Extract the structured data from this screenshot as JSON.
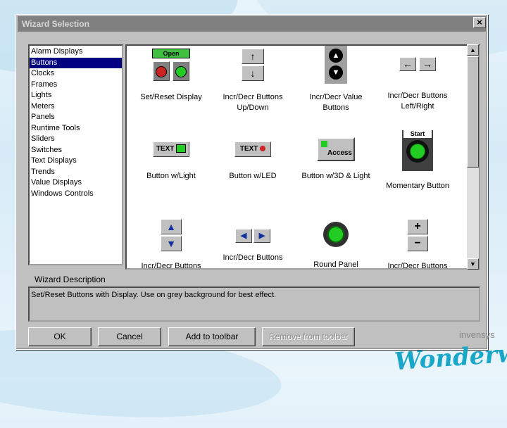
{
  "window": {
    "title": "Wizard Selection",
    "close": "×"
  },
  "categories": [
    {
      "label": "Alarm Displays"
    },
    {
      "label": "Buttons"
    },
    {
      "label": "Clocks"
    },
    {
      "label": "Frames"
    },
    {
      "label": "Lights"
    },
    {
      "label": "Meters"
    },
    {
      "label": "Panels"
    },
    {
      "label": "Runtime Tools"
    },
    {
      "label": "Sliders"
    },
    {
      "label": "Switches"
    },
    {
      "label": "Text Displays"
    },
    {
      "label": "Trends"
    },
    {
      "label": "Value Displays"
    },
    {
      "label": "Windows Controls"
    }
  ],
  "selected_category": "Buttons",
  "wizards": [
    {
      "label": "Set/Reset Display",
      "icon": "set-reset-display-icon",
      "icon_text": "Open"
    },
    {
      "label": "Incr/Decr Buttons\nUp/Down",
      "icon": "up-down-arrows-icon"
    },
    {
      "label": "Incr/Decr Value\nButtons",
      "icon": "value-buttons-icon"
    },
    {
      "label": "Incr/Decr Buttons\nLeft/Right",
      "icon": "left-right-arrows-icon"
    },
    {
      "label": "Button w/Light",
      "icon": "button-with-light-icon",
      "icon_text": "TEXT"
    },
    {
      "label": "Button w/LED",
      "icon": "button-with-led-icon",
      "icon_text": "TEXT"
    },
    {
      "label": "Button w/3D & Light",
      "icon": "button-3d-light-icon",
      "icon_text": "Access"
    },
    {
      "label": "Momentary Button",
      "icon": "momentary-button-icon",
      "icon_text": "Start"
    },
    {
      "label": "Incr/Decr Buttons",
      "icon": "triangle-up-down-icon"
    },
    {
      "label": "Incr/Decr Buttons",
      "icon": "triangle-left-right-icon"
    },
    {
      "label": "Round Panel",
      "icon": "round-panel-icon"
    },
    {
      "label": "Incr/Decr Buttons",
      "icon": "plus-minus-icon"
    }
  ],
  "description": {
    "label": "Wizard Description",
    "text": "Set/Reset Buttons with Display.  Use on grey background for best effect."
  },
  "buttons": {
    "ok": "OK",
    "cancel": "Cancel",
    "add": "Add to toolbar",
    "remove": "Remove from toolbar"
  },
  "branding": {
    "company": "invensys",
    "logo": "Wonderware"
  },
  "colors": {
    "selection": "#000080",
    "led_green": "#22cc22",
    "led_red": "#cc2222"
  }
}
